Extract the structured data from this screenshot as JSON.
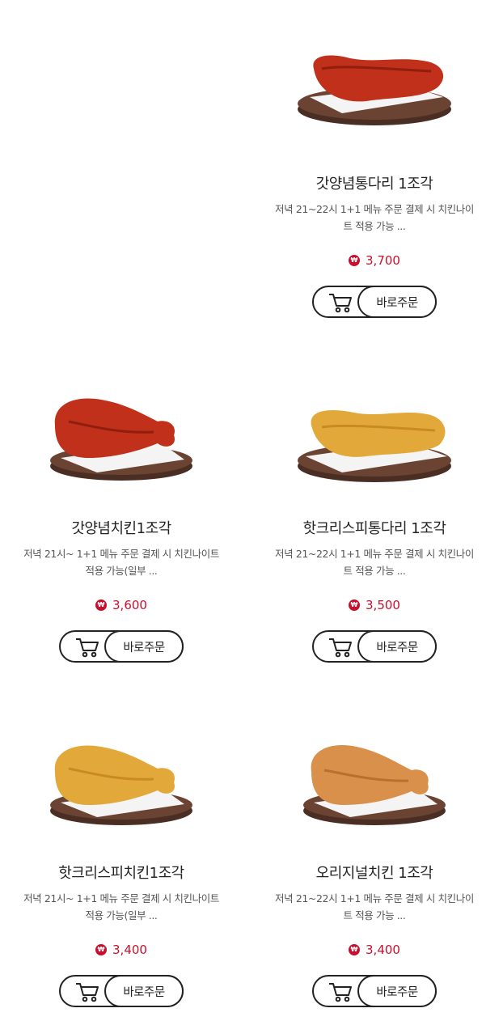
{
  "currency_symbol": "₩",
  "order_button_label": "바로주문",
  "products": [
    {
      "name": "갓양념통다리 1조각",
      "desc_line1": "저녁 21~22시 1+1 메뉴 주문 결제 시 치킨나이",
      "desc_line2": "트 적용 가능 ...",
      "price": "3,700"
    },
    {
      "name": "갓양념치킨1조각",
      "desc_line1": "저녁 21시~ 1+1 메뉴 주문 결제 시 치킨나이트",
      "desc_line2": "적용 가능(일부 ...",
      "price": "3,600"
    },
    {
      "name": "핫크리스피통다리 1조각",
      "desc_line1": "저녁 21~22시 1+1 메뉴 주문 결제 시 치킨나이",
      "desc_line2": "트 적용 가능 ...",
      "price": "3,500"
    },
    {
      "name": "핫크리스피치킨1조각",
      "desc_line1": "저녁 21시~ 1+1 메뉴 주문 결제 시 치킨나이트",
      "desc_line2": "적용 가능(일부 ...",
      "price": "3,400"
    },
    {
      "name": "오리지널치킨 1조각",
      "desc_line1": "저녁 21~22시 1+1 메뉴 주문 결제 시 치킨나이",
      "desc_line2": "트 적용 가능 ...",
      "price": "3,400"
    }
  ],
  "colors": {
    "price": "#c8102e",
    "border": "#222222",
    "sauce_red": "#c0301a",
    "crispy": "#e2a93a",
    "original": "#d9904a",
    "plate": "#5a3a2e"
  },
  "icons": {
    "cart": "shopping-cart-icon",
    "won": "won-currency-icon"
  }
}
